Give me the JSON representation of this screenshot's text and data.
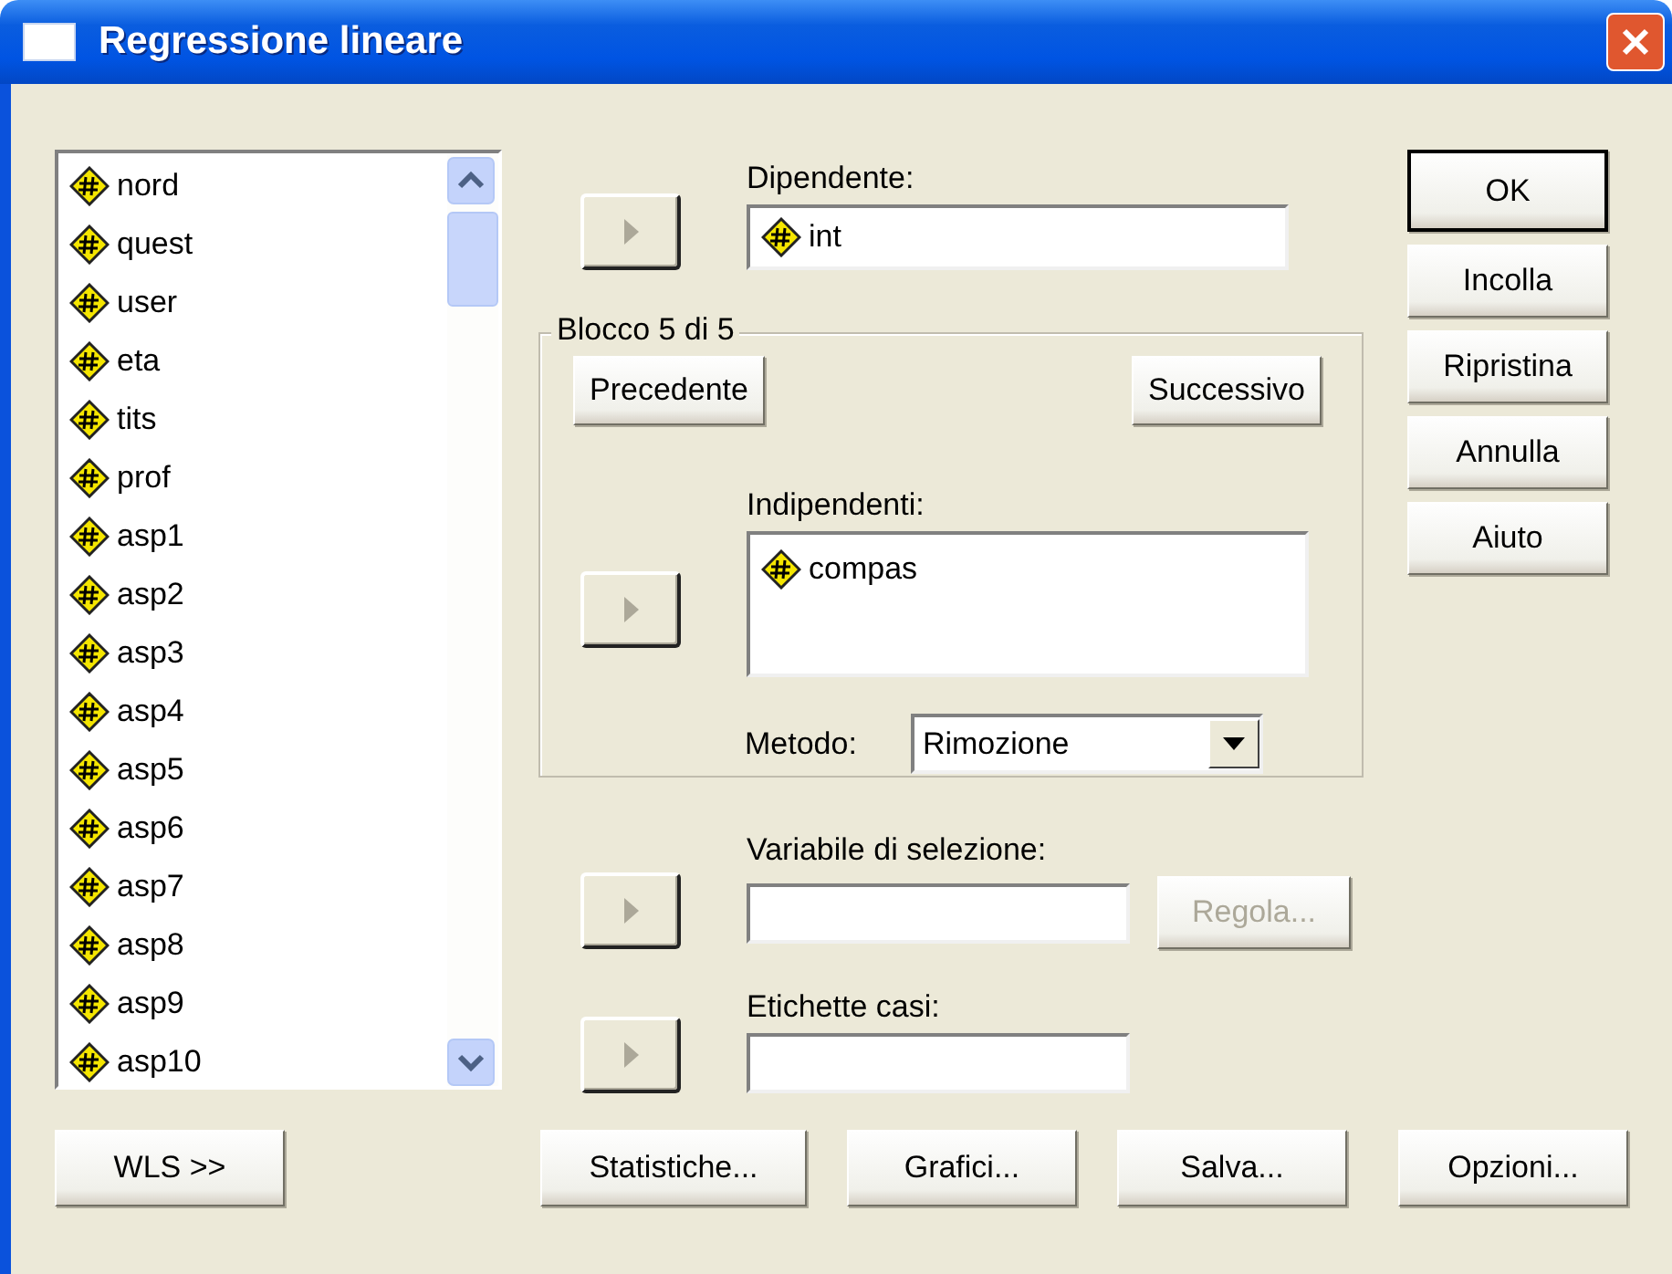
{
  "window": {
    "title": "Regressione lineare"
  },
  "variables": [
    {
      "name": "nord"
    },
    {
      "name": "quest"
    },
    {
      "name": "user"
    },
    {
      "name": "eta"
    },
    {
      "name": "tits"
    },
    {
      "name": "prof"
    },
    {
      "name": "asp1"
    },
    {
      "name": "asp2"
    },
    {
      "name": "asp3"
    },
    {
      "name": "asp4"
    },
    {
      "name": "asp5"
    },
    {
      "name": "asp6"
    },
    {
      "name": "asp7"
    },
    {
      "name": "asp8"
    },
    {
      "name": "asp9"
    },
    {
      "name": "asp10"
    }
  ],
  "dependent": {
    "label": "Dipendente:",
    "value": "int"
  },
  "block": {
    "legend": "Blocco 5 di 5",
    "previous": {
      "label": "Precedente"
    },
    "next": {
      "label": "Successivo"
    },
    "independents": {
      "label": "Indipendenti:",
      "items": [
        {
          "name": "compas"
        }
      ]
    },
    "method": {
      "label": "Metodo:",
      "value": "Rimozione"
    }
  },
  "selection_variable": {
    "label": "Variabile di selezione:",
    "rule_button": {
      "label": "Regola...",
      "disabled": true
    }
  },
  "case_labels": {
    "label": "Etichette casi:"
  },
  "side_buttons": [
    {
      "label": "OK",
      "default": true
    },
    {
      "label": "Incolla",
      "default": false
    },
    {
      "label": "Ripristina",
      "default": false
    },
    {
      "label": "Annulla",
      "default": false
    },
    {
      "label": "Aiuto",
      "default": false
    }
  ],
  "bottom_buttons": [
    {
      "label": "WLS >>"
    },
    {
      "label": "Statistiche..."
    },
    {
      "label": "Grafici..."
    },
    {
      "label": "Salva..."
    },
    {
      "label": "Opzioni..."
    }
  ]
}
